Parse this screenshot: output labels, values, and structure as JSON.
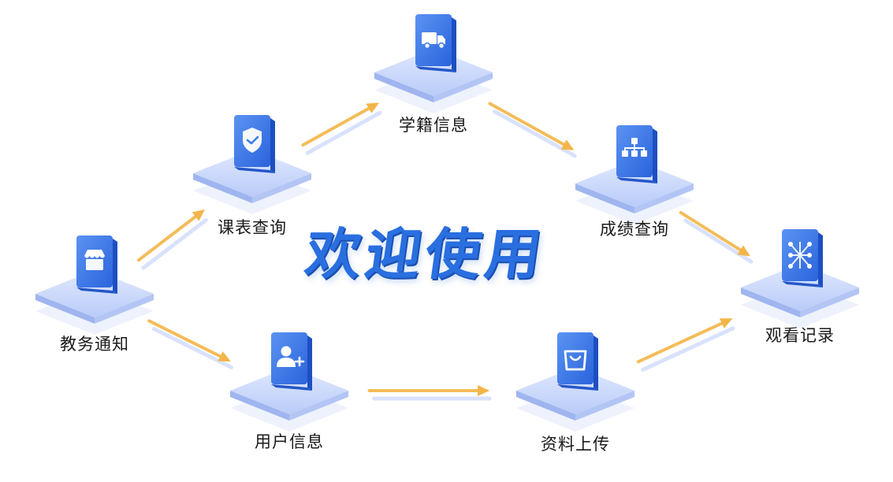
{
  "headline": "欢迎使用",
  "nodes": [
    {
      "id": "jiaowu",
      "label": "教务通知",
      "icon": "storefront-icon"
    },
    {
      "id": "kebiao",
      "label": "课表查询",
      "icon": "shield-check-icon"
    },
    {
      "id": "xueji",
      "label": "学籍信息",
      "icon": "delivery-truck-icon"
    },
    {
      "id": "chengji",
      "label": "成绩查询",
      "icon": "org-chart-icon"
    },
    {
      "id": "guankan",
      "label": "观看记录",
      "icon": "network-nodes-icon"
    },
    {
      "id": "yonghu",
      "label": "用户信息",
      "icon": "add-user-icon"
    },
    {
      "id": "ziliao",
      "label": "资料上传",
      "icon": "shopping-bag-icon"
    }
  ],
  "edges": [
    {
      "from": "jiaowu",
      "to": "kebiao"
    },
    {
      "from": "kebiao",
      "to": "xueji"
    },
    {
      "from": "xueji",
      "to": "chengji"
    },
    {
      "from": "chengji",
      "to": "guankan"
    },
    {
      "from": "jiaowu",
      "to": "yonghu"
    },
    {
      "from": "yonghu",
      "to": "ziliao"
    },
    {
      "from": "ziliao",
      "to": "guankan"
    }
  ],
  "colors": {
    "accent": "#2a6fe0",
    "platform": "#c7d6fb",
    "icon_tile": "#3b7be8",
    "arrow": "#f3b548"
  }
}
